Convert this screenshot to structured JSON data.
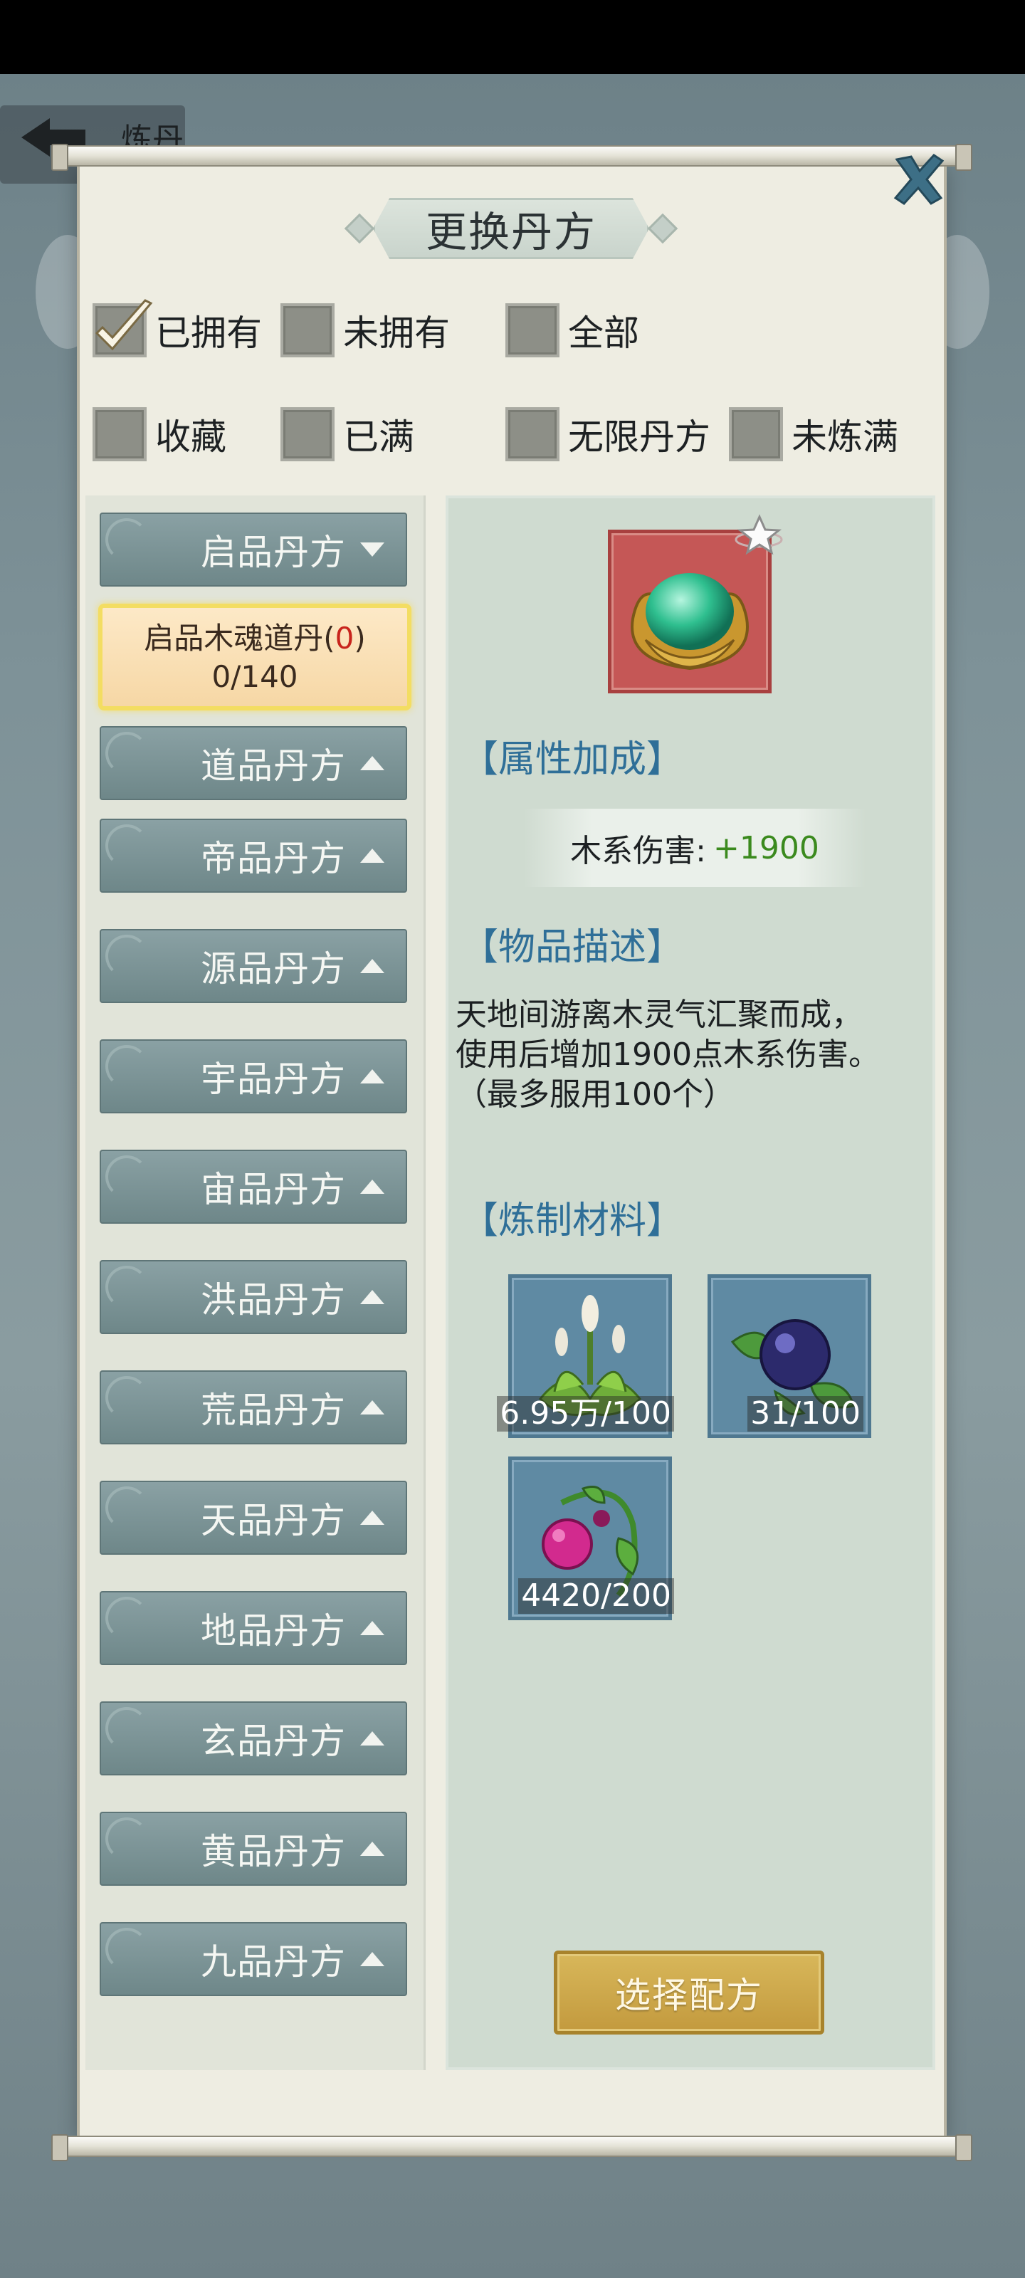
{
  "background": {
    "screen_title": "炼丹"
  },
  "dialog": {
    "title": "更换丹方"
  },
  "filters": [
    {
      "label": "已拥有",
      "checked": true
    },
    {
      "label": "未拥有",
      "checked": false
    },
    {
      "label": "全部",
      "checked": false
    },
    {
      "label": "收藏",
      "checked": false
    },
    {
      "label": "已满",
      "checked": false
    },
    {
      "label": "无限丹方",
      "checked": false
    },
    {
      "label": "未炼满",
      "checked": false
    }
  ],
  "categories": [
    {
      "label": "启品丹方",
      "expanded": true
    },
    {
      "label": "道品丹方",
      "expanded": false
    },
    {
      "label": "帝品丹方",
      "expanded": false
    },
    {
      "label": "源品丹方",
      "expanded": false
    },
    {
      "label": "宇品丹方",
      "expanded": false
    },
    {
      "label": "宙品丹方",
      "expanded": false
    },
    {
      "label": "洪品丹方",
      "expanded": false
    },
    {
      "label": "荒品丹方",
      "expanded": false
    },
    {
      "label": "天品丹方",
      "expanded": false
    },
    {
      "label": "地品丹方",
      "expanded": false
    },
    {
      "label": "玄品丹方",
      "expanded": false
    },
    {
      "label": "黄品丹方",
      "expanded": false
    },
    {
      "label": "九品丹方",
      "expanded": false
    }
  ],
  "selected_recipe": {
    "name": "启品木魂道丹",
    "count_open": "(",
    "count": "0",
    "count_close": ")",
    "progress": "0/140"
  },
  "detail": {
    "attr_title": "【属性加成】",
    "attr_name": "木系伤害:",
    "attr_value": "+1900",
    "desc_title": "【物品描述】",
    "desc_line1": "天地间游离木灵气汇聚而成，",
    "desc_line2": "使用后增加1900点木系伤害。",
    "desc_line3": "（最多服用100个）",
    "materials_title": "【炼制材料】",
    "materials": [
      {
        "name": "herb-plant",
        "quantity": "6.95万/100"
      },
      {
        "name": "blue-berry",
        "quantity": "31/100"
      },
      {
        "name": "pink-berry-vine",
        "quantity": "4420/200"
      }
    ],
    "select_button": "选择配方"
  },
  "colors": {
    "accent_blue": "#2f6f98",
    "positive_green": "#3b8a1e",
    "count_red": "#c8241c",
    "button_gold": "#c39a3e"
  }
}
